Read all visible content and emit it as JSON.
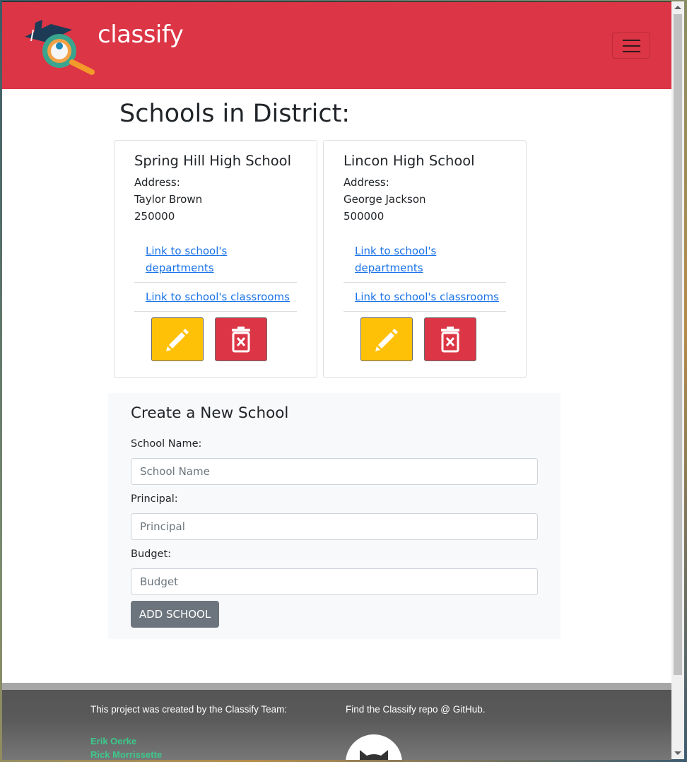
{
  "app": {
    "brand": "classify"
  },
  "main": {
    "title": "Schools in District:"
  },
  "schools": [
    {
      "name": "Spring Hill High School",
      "address_label": "Address:",
      "principal": "Taylor Brown",
      "budget": "250000",
      "departments_link_line1": "Link to school's",
      "departments_link_line2": "departments",
      "classrooms_link": "Link to school's classrooms",
      "edit_icon": "pencil-icon",
      "delete_icon": "trash-icon"
    },
    {
      "name": "Lincon High School",
      "address_label": "Address:",
      "principal": "George Jackson",
      "budget": "500000",
      "departments_link_line1": "Link to school's",
      "departments_link_line2": "departments",
      "classrooms_link": "Link to school's classrooms",
      "edit_icon": "pencil-icon",
      "delete_icon": "trash-icon"
    }
  ],
  "form": {
    "title": "Create a New School",
    "school_name_label": "School Name:",
    "school_name_placeholder": "School Name",
    "principal_label": "Principal:",
    "principal_placeholder": "Principal",
    "budget_label": "Budget:",
    "budget_placeholder": "Budget",
    "submit_label": "ADD SCHOOL"
  },
  "footer": {
    "team_text": "This project was created by the Classify Team:",
    "repo_text": "Find the Classify repo @ GitHub.",
    "members": [
      "Erik Oerke",
      "Rick Morrissette"
    ]
  },
  "colors": {
    "navbar": "#dc3545",
    "edit_button": "#ffc107",
    "delete_button": "#dc3545",
    "link": "#1a73e8",
    "member_name": "#3cc98b"
  }
}
